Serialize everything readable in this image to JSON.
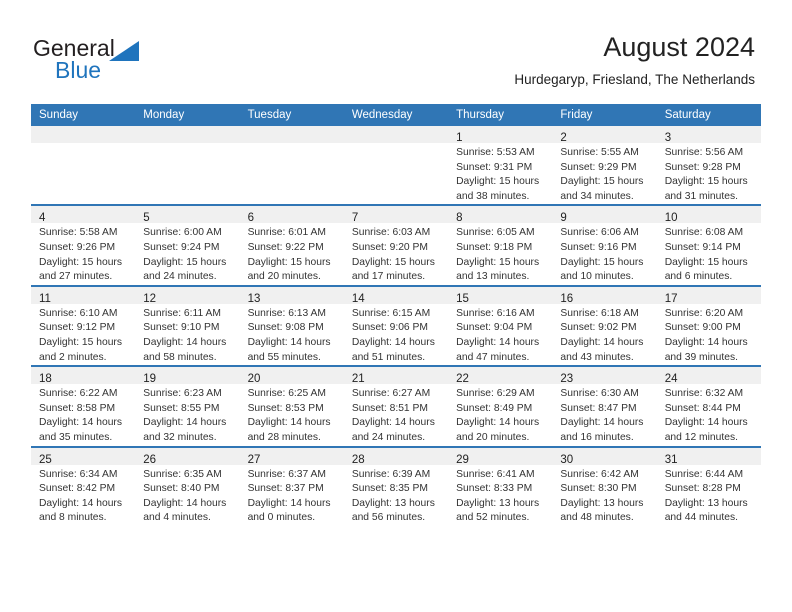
{
  "brand": {
    "name_part1": "General",
    "name_part2": "Blue",
    "color_text": "#231f20",
    "color_blue": "#1f74bd"
  },
  "header": {
    "title": "August 2024",
    "subtitle": "Hurdegaryp, Friesland, The Netherlands"
  },
  "calendar": {
    "accent_color": "#3076b5",
    "daynum_band_color": "#f0f0f0",
    "weekdays": [
      "Sunday",
      "Monday",
      "Tuesday",
      "Wednesday",
      "Thursday",
      "Friday",
      "Saturday"
    ],
    "weeks": [
      [
        {
          "day": "",
          "lines": []
        },
        {
          "day": "",
          "lines": []
        },
        {
          "day": "",
          "lines": []
        },
        {
          "day": "",
          "lines": []
        },
        {
          "day": "1",
          "lines": [
            "Sunrise: 5:53 AM",
            "Sunset: 9:31 PM",
            "Daylight: 15 hours",
            "and 38 minutes."
          ]
        },
        {
          "day": "2",
          "lines": [
            "Sunrise: 5:55 AM",
            "Sunset: 9:29 PM",
            "Daylight: 15 hours",
            "and 34 minutes."
          ]
        },
        {
          "day": "3",
          "lines": [
            "Sunrise: 5:56 AM",
            "Sunset: 9:28 PM",
            "Daylight: 15 hours",
            "and 31 minutes."
          ]
        }
      ],
      [
        {
          "day": "4",
          "lines": [
            "Sunrise: 5:58 AM",
            "Sunset: 9:26 PM",
            "Daylight: 15 hours",
            "and 27 minutes."
          ]
        },
        {
          "day": "5",
          "lines": [
            "Sunrise: 6:00 AM",
            "Sunset: 9:24 PM",
            "Daylight: 15 hours",
            "and 24 minutes."
          ]
        },
        {
          "day": "6",
          "lines": [
            "Sunrise: 6:01 AM",
            "Sunset: 9:22 PM",
            "Daylight: 15 hours",
            "and 20 minutes."
          ]
        },
        {
          "day": "7",
          "lines": [
            "Sunrise: 6:03 AM",
            "Sunset: 9:20 PM",
            "Daylight: 15 hours",
            "and 17 minutes."
          ]
        },
        {
          "day": "8",
          "lines": [
            "Sunrise: 6:05 AM",
            "Sunset: 9:18 PM",
            "Daylight: 15 hours",
            "and 13 minutes."
          ]
        },
        {
          "day": "9",
          "lines": [
            "Sunrise: 6:06 AM",
            "Sunset: 9:16 PM",
            "Daylight: 15 hours",
            "and 10 minutes."
          ]
        },
        {
          "day": "10",
          "lines": [
            "Sunrise: 6:08 AM",
            "Sunset: 9:14 PM",
            "Daylight: 15 hours",
            "and 6 minutes."
          ]
        }
      ],
      [
        {
          "day": "11",
          "lines": [
            "Sunrise: 6:10 AM",
            "Sunset: 9:12 PM",
            "Daylight: 15 hours",
            "and 2 minutes."
          ]
        },
        {
          "day": "12",
          "lines": [
            "Sunrise: 6:11 AM",
            "Sunset: 9:10 PM",
            "Daylight: 14 hours",
            "and 58 minutes."
          ]
        },
        {
          "day": "13",
          "lines": [
            "Sunrise: 6:13 AM",
            "Sunset: 9:08 PM",
            "Daylight: 14 hours",
            "and 55 minutes."
          ]
        },
        {
          "day": "14",
          "lines": [
            "Sunrise: 6:15 AM",
            "Sunset: 9:06 PM",
            "Daylight: 14 hours",
            "and 51 minutes."
          ]
        },
        {
          "day": "15",
          "lines": [
            "Sunrise: 6:16 AM",
            "Sunset: 9:04 PM",
            "Daylight: 14 hours",
            "and 47 minutes."
          ]
        },
        {
          "day": "16",
          "lines": [
            "Sunrise: 6:18 AM",
            "Sunset: 9:02 PM",
            "Daylight: 14 hours",
            "and 43 minutes."
          ]
        },
        {
          "day": "17",
          "lines": [
            "Sunrise: 6:20 AM",
            "Sunset: 9:00 PM",
            "Daylight: 14 hours",
            "and 39 minutes."
          ]
        }
      ],
      [
        {
          "day": "18",
          "lines": [
            "Sunrise: 6:22 AM",
            "Sunset: 8:58 PM",
            "Daylight: 14 hours",
            "and 35 minutes."
          ]
        },
        {
          "day": "19",
          "lines": [
            "Sunrise: 6:23 AM",
            "Sunset: 8:55 PM",
            "Daylight: 14 hours",
            "and 32 minutes."
          ]
        },
        {
          "day": "20",
          "lines": [
            "Sunrise: 6:25 AM",
            "Sunset: 8:53 PM",
            "Daylight: 14 hours",
            "and 28 minutes."
          ]
        },
        {
          "day": "21",
          "lines": [
            "Sunrise: 6:27 AM",
            "Sunset: 8:51 PM",
            "Daylight: 14 hours",
            "and 24 minutes."
          ]
        },
        {
          "day": "22",
          "lines": [
            "Sunrise: 6:29 AM",
            "Sunset: 8:49 PM",
            "Daylight: 14 hours",
            "and 20 minutes."
          ]
        },
        {
          "day": "23",
          "lines": [
            "Sunrise: 6:30 AM",
            "Sunset: 8:47 PM",
            "Daylight: 14 hours",
            "and 16 minutes."
          ]
        },
        {
          "day": "24",
          "lines": [
            "Sunrise: 6:32 AM",
            "Sunset: 8:44 PM",
            "Daylight: 14 hours",
            "and 12 minutes."
          ]
        }
      ],
      [
        {
          "day": "25",
          "lines": [
            "Sunrise: 6:34 AM",
            "Sunset: 8:42 PM",
            "Daylight: 14 hours",
            "and 8 minutes."
          ]
        },
        {
          "day": "26",
          "lines": [
            "Sunrise: 6:35 AM",
            "Sunset: 8:40 PM",
            "Daylight: 14 hours",
            "and 4 minutes."
          ]
        },
        {
          "day": "27",
          "lines": [
            "Sunrise: 6:37 AM",
            "Sunset: 8:37 PM",
            "Daylight: 14 hours",
            "and 0 minutes."
          ]
        },
        {
          "day": "28",
          "lines": [
            "Sunrise: 6:39 AM",
            "Sunset: 8:35 PM",
            "Daylight: 13 hours",
            "and 56 minutes."
          ]
        },
        {
          "day": "29",
          "lines": [
            "Sunrise: 6:41 AM",
            "Sunset: 8:33 PM",
            "Daylight: 13 hours",
            "and 52 minutes."
          ]
        },
        {
          "day": "30",
          "lines": [
            "Sunrise: 6:42 AM",
            "Sunset: 8:30 PM",
            "Daylight: 13 hours",
            "and 48 minutes."
          ]
        },
        {
          "day": "31",
          "lines": [
            "Sunrise: 6:44 AM",
            "Sunset: 8:28 PM",
            "Daylight: 13 hours",
            "and 44 minutes."
          ]
        }
      ]
    ]
  }
}
